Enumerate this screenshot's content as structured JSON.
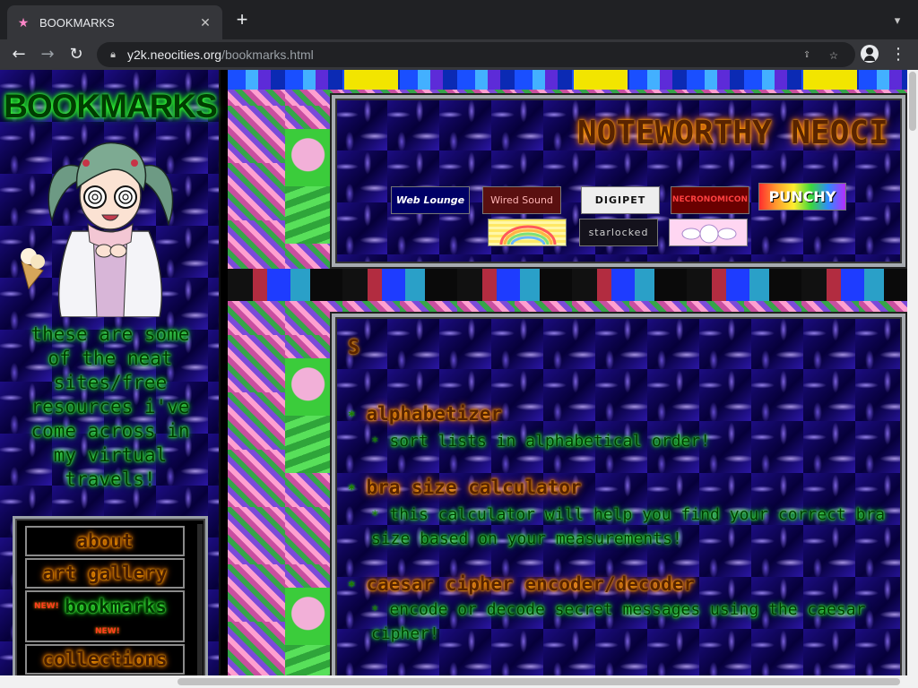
{
  "browser": {
    "tab_title": "BOOKMARKS",
    "url_host": "y2k.neocities.org",
    "url_path": "/bookmarks.html",
    "icons": {
      "tab_favicon": "star-icon",
      "tab_close": "close-icon",
      "new_tab": "plus-icon",
      "tab_search": "chevron-down-icon",
      "back": "arrow-left-icon",
      "forward": "arrow-right-icon",
      "reload": "reload-icon",
      "lock": "lock-icon",
      "share": "share-icon",
      "bookmark_star": "star-outline-icon",
      "profile": "profile-icon",
      "menu": "kebab-menu-icon"
    }
  },
  "sidebar": {
    "title": "BOOKMARKS",
    "description": "these are some of the neat sites/free resources i've come across in my virtual travels!",
    "nav": [
      {
        "label": "about"
      },
      {
        "label": "art gallery"
      },
      {
        "label": "bookmarks",
        "badge": "NEW!"
      },
      {
        "label": "collections"
      }
    ]
  },
  "noteworthy": {
    "title": "NOTEWORTHY NEOCI",
    "badges": [
      "Web Lounge",
      "Wired Sound",
      "DIGIPET",
      "NECRONOMICON",
      "PUNCHY",
      "",
      "starlocked",
      ""
    ]
  },
  "content": {
    "heading": "S",
    "bookmarks": [
      {
        "title": "alphabetizer",
        "desc": "sort lists in alphabetical order!"
      },
      {
        "title": "bra size calculator",
        "desc": "this calculator will help you find your correct bra size based on your measurements!"
      },
      {
        "title": "caesar cipher encoder/decoder",
        "desc": "encode or decode secret messages using the caesar cipher!"
      }
    ]
  },
  "colors": {
    "neon_green": "#33ff33",
    "neon_orange": "#ff8c00",
    "background_blue": "#070047"
  }
}
